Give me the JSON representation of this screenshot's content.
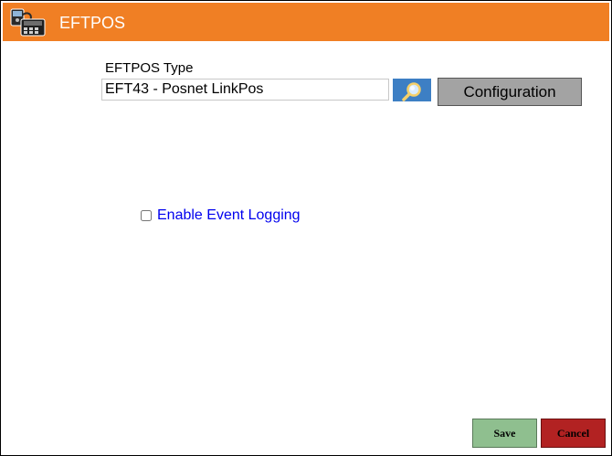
{
  "window": {
    "title": "EFTPOS",
    "title_icon": "card-terminal-icon",
    "accent_color": "#f07f24"
  },
  "eftpos_type": {
    "label": "EFTPOS Type",
    "value": "EFT43 - Posnet LinkPos",
    "search_icon": "magnifier-icon",
    "configuration_label": "Configuration"
  },
  "logging": {
    "label": "Enable Event Logging",
    "checked": false,
    "label_color": "#0000ee"
  },
  "footer": {
    "save_label": "Save",
    "save_color": "#8fbf8f",
    "cancel_label": "Cancel",
    "cancel_color": "#b22222"
  }
}
